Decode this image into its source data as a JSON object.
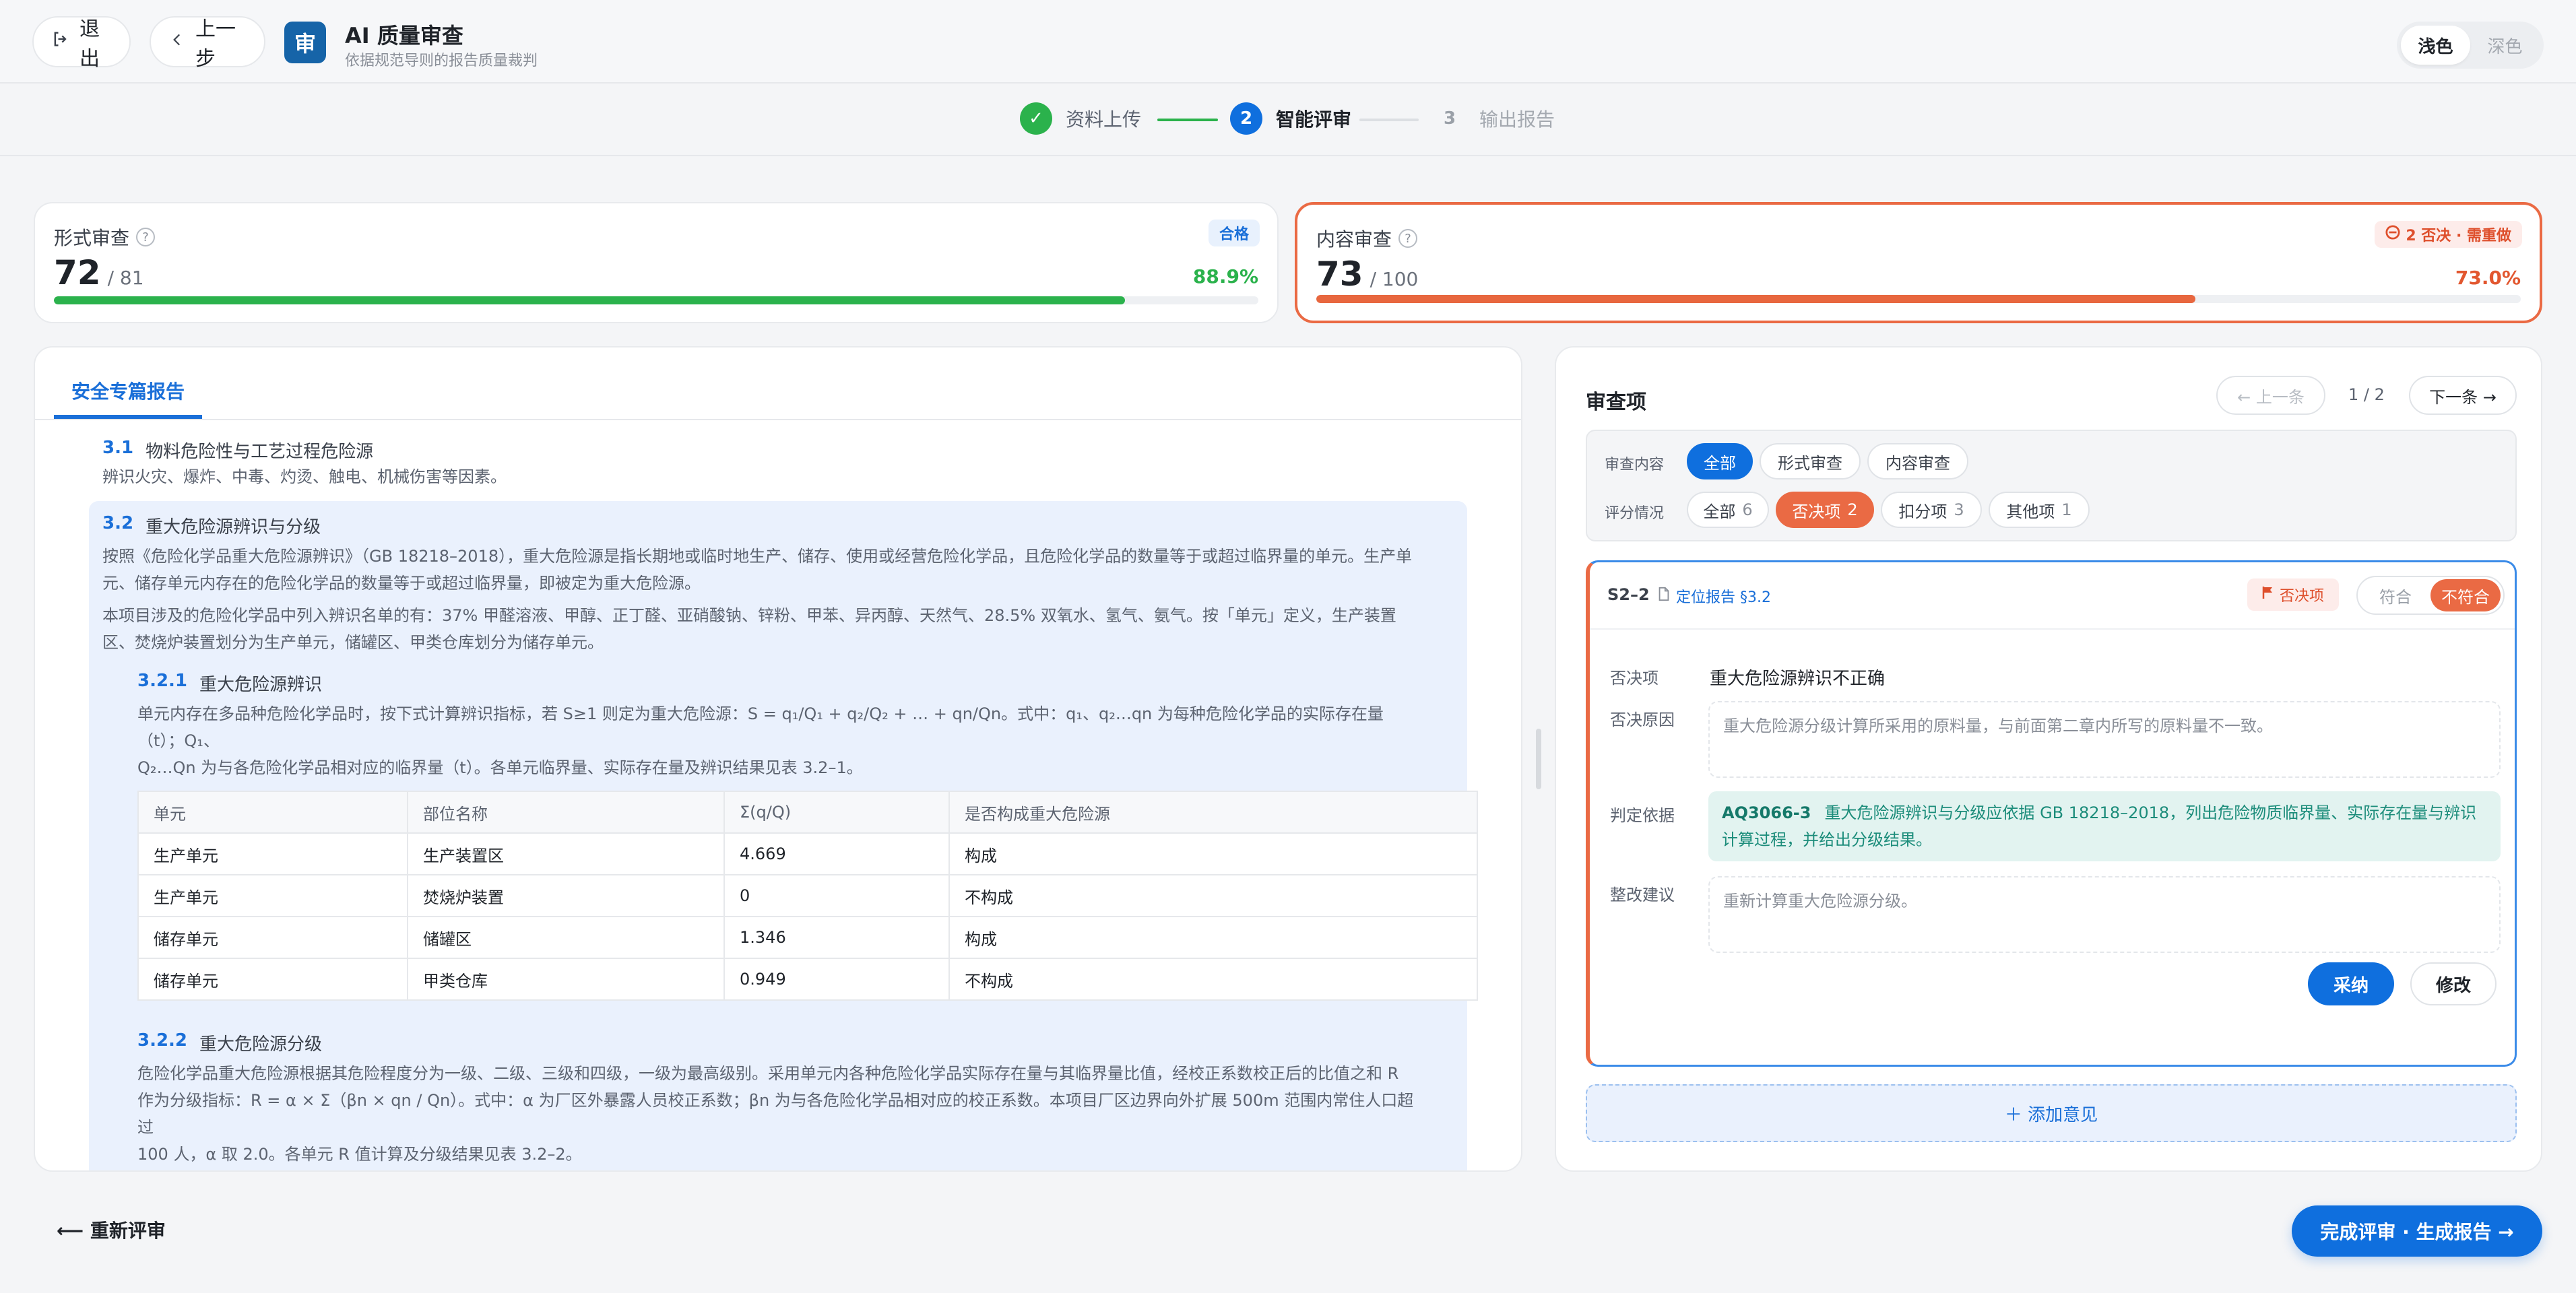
{
  "header": {
    "exit_label": "退出",
    "back_label": "上一步",
    "logo_char": "审",
    "title": "AI 质量审查",
    "subtitle": "依据规范导则的报告质量裁判",
    "theme": {
      "light": "浅色",
      "dark": "深色",
      "selected": "浅色"
    }
  },
  "stepper": {
    "steps": [
      {
        "num": "✓",
        "label": "资料上传",
        "state": "done"
      },
      {
        "num": "2",
        "label": "智能评审",
        "state": "active"
      },
      {
        "num": "3",
        "label": "输出报告",
        "state": "todo"
      }
    ]
  },
  "score_cards": {
    "form": {
      "label": "形式审查",
      "help": "?",
      "score": "72",
      "total": "/ 81",
      "badge": "合格",
      "pct": "88.9%",
      "fraction": 0.889
    },
    "content": {
      "label": "内容审查",
      "help": "?",
      "score": "73",
      "total": "/ 100",
      "badge": "2 否决 · 需重做",
      "pct": "73.0%",
      "fraction": 0.73
    }
  },
  "report": {
    "tab": "安全专篇报告",
    "s31": {
      "num": "3.1",
      "title": "物料危险性与工艺过程危险源",
      "text": "辨识火灾、爆炸、中毒、灼烫、触电、机械伤害等因素。"
    },
    "s32": {
      "num": "3.2",
      "title": "重大危险源辨识与分级",
      "p1_line1": "按照《危险化学品重大危险源辨识》（GB 18218–2018），重大危险源是指长期地或临时地生产、储存、使用或经营危险化学品，且危险化学品的数量等于或超过临界量的单元。生产单",
      "p1_line2": "元、储存单元内存在的危险化学品的数量等于或超过临界量，即被定为重大危险源。",
      "p2_line1": "本项目涉及的危险化学品中列入辨识名单的有：37% 甲醛溶液、甲醇、正丁醛、亚硝酸钠、锌粉、甲苯、异丙醇、天然气、28.5% 双氧水、氢气、氨气。按「单元」定义，生产装置",
      "p2_line2": "区、焚烧炉装置划分为生产单元，储罐区、甲类仓库划分为储存单元。"
    },
    "s321": {
      "num": "3.2.1",
      "title": "重大危险源辨识",
      "l1": "单元内存在多品种危险化学品时，按下式计算辨识指标，若 S≥1 则定为重大危险源：S = q₁/Q₁ + q₂/Q₂ + … + qn/Qn。式中：q₁、q₂…qn 为每种危险化学品的实际存在量",
      "l2": "（t）；Q₁、",
      "l3": "Q₂…Qn 为与各危险化学品相对应的临界量（t）。各单元临界量、实际存在量及辨识结果见表 3.2–1。"
    },
    "table": {
      "headers": [
        "单元",
        "部位名称",
        "Σ(q/Q)",
        "是否构成重大危险源"
      ],
      "rows": [
        [
          "生产单元",
          "生产装置区",
          "4.669",
          "构成"
        ],
        [
          "生产单元",
          "焚烧炉装置",
          "0",
          "不构成"
        ],
        [
          "储存单元",
          "储罐区",
          "1.346",
          "构成"
        ],
        [
          "储存单元",
          "甲类仓库",
          "0.949",
          "不构成"
        ]
      ]
    },
    "s322": {
      "num": "3.2.2",
      "title": "重大危险源分级",
      "l1": "危险化学品重大危险源根据其危险程度分为一级、二级、三级和四级，一级为最高级别。采用单元内各种危险化学品实际存在量与其临界量比值，经校正系数校正后的比值之和 R",
      "l2": "作为分级指标：R = α × Σ（βn × qn / Qn）。式中：α 为厂区外暴露人员校正系数；βn 为与各危险化学品相对应的校正系数。本项目厂区边界向外扩展 500m 范围内常住人口超",
      "l3": "过",
      "l4": "100 人，α 取 2.0。各单元 R 值计算及分级结果见表 3.2–2。"
    }
  },
  "review": {
    "title": "审查项",
    "prev": "← 上一条",
    "count": "1 / 2",
    "next": "下一条 →",
    "filter_content_label": "审查内容",
    "content_chips": [
      "全部",
      "形式审查",
      "内容审查"
    ],
    "filter_score_label": "评分情况",
    "score_chips": [
      {
        "label": "全部",
        "count": "6"
      },
      {
        "label": "否决项",
        "count": "2"
      },
      {
        "label": "扣分项",
        "count": "3"
      },
      {
        "label": "其他项",
        "count": "1"
      }
    ],
    "issue": {
      "id": "S2–2",
      "locate": "定位报告 §3.2",
      "veto_tag": "否决项",
      "seg_pass": "符合",
      "seg_fail": "不符合",
      "veto_label": "否决项",
      "veto_value": "重大危险源辨识不正确",
      "reason_label": "否决原因",
      "reason_value": "重大危险源分级计算所采用的原料量，与前面第二章内所写的原料量不一致。",
      "basis_label": "判定依据",
      "basis_code": "AQ3066-3",
      "basis_text": "重大危险源辨识与分级应依据 GB 18218–2018，列出危险物质临界量、实际存在量与辨识计算过程，并给出分级结果。",
      "suggest_label": "整改建议",
      "suggest_value": "重新计算重大危险源分级。",
      "accept": "采纳",
      "edit": "修改"
    },
    "add_opinion": "＋ 添加意见"
  },
  "footer": {
    "re_review": "⟵ 重新评审",
    "finish": "完成评审 · 生成报告 →"
  }
}
